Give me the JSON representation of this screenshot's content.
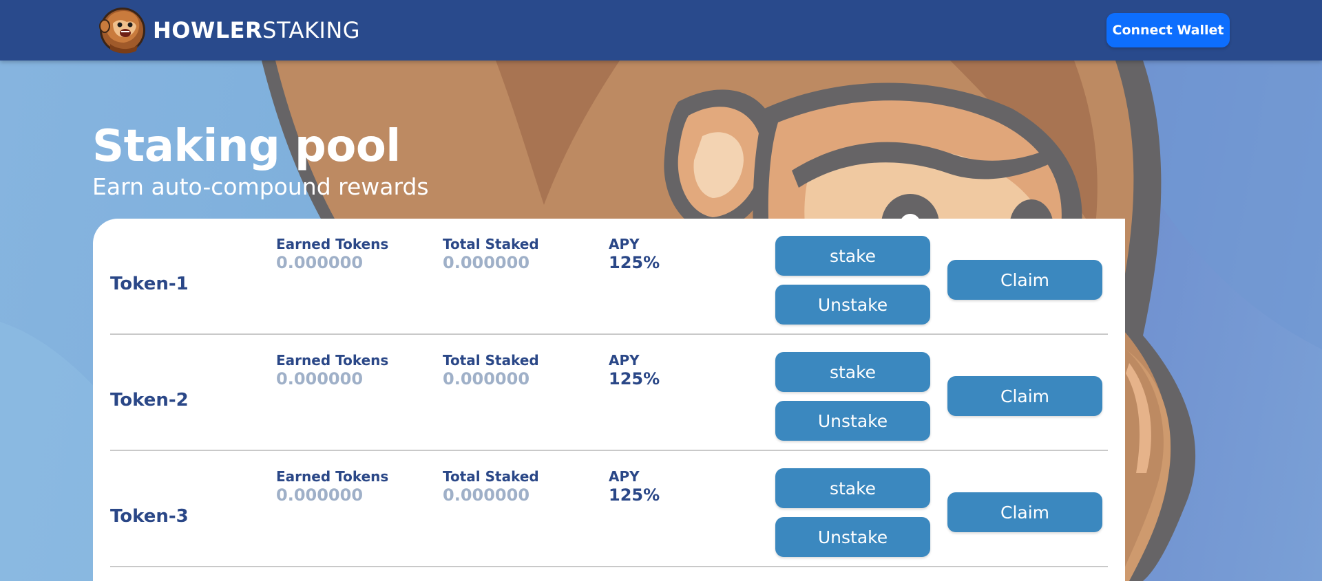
{
  "header": {
    "brand_bold": "HOWLER",
    "brand_light": "STAKING",
    "logo_icon": "monkey-mascot-logo",
    "connect_label": "Connect Wallet",
    "bg_color": "#294a8c",
    "button_color": "#0d6efd"
  },
  "hero": {
    "title": "Staking pool",
    "subtitle": "Earn auto-compound rewards"
  },
  "pool": {
    "rows": [
      {
        "name": "Token-1",
        "earned_label": "Earned Tokens",
        "earned_value": "0.000000",
        "staked_label": "Total Staked",
        "staked_value": "0.000000",
        "apy_label": "APY",
        "apy_value": "125%",
        "stake_label": "stake",
        "unstake_label": "Unstake",
        "claim_label": "Claim"
      },
      {
        "name": "Token-2",
        "earned_label": "Earned Tokens",
        "earned_value": "0.000000",
        "staked_label": "Total Staked",
        "staked_value": "0.000000",
        "apy_label": "APY",
        "apy_value": "125%",
        "stake_label": "stake",
        "unstake_label": "Unstake",
        "claim_label": "Claim"
      },
      {
        "name": "Token-3",
        "earned_label": "Earned Tokens",
        "earned_value": "0.000000",
        "staked_label": "Total Staked",
        "staked_value": "0.000000",
        "apy_label": "APY",
        "apy_value": "125%",
        "stake_label": "stake",
        "unstake_label": "Unstake",
        "claim_label": "Claim"
      }
    ],
    "button_color": "#3b88bf",
    "label_color": "#2a4787"
  }
}
